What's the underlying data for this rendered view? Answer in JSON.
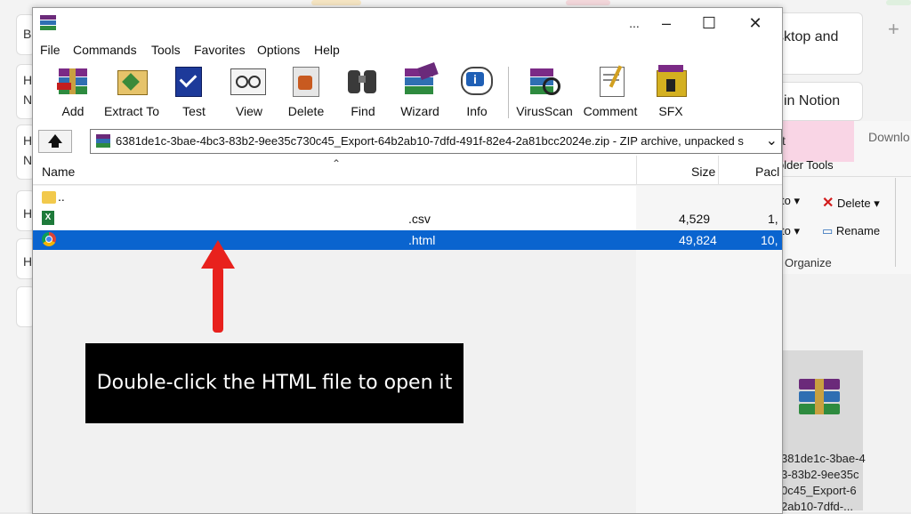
{
  "background_page": {
    "cards": [
      "sktop and",
      "in Notion"
    ],
    "sidebar_letters": [
      "B",
      "H",
      "N",
      "H",
      "N",
      "H",
      "H"
    ],
    "plus_label": "+"
  },
  "explorer": {
    "tabs": [
      "ct",
      "Downlo"
    ],
    "group_label": "older Tools",
    "move_to": "to",
    "copy_to": "to",
    "delete_label": "Delete",
    "rename_label": "Rename",
    "organize_label": "Organize",
    "file_name_lines": [
      "381de1c-3bae-4",
      "3-83b2-9ee35c",
      "0c45_Export-6",
      "2ab10-7dfd-..."
    ]
  },
  "winrar": {
    "titlebar": {
      "more": "...",
      "minimize": "–",
      "maximize": "☐",
      "close": "✕"
    },
    "menu": [
      "File",
      "Commands",
      "Tools",
      "Favorites",
      "Options",
      "Help"
    ],
    "toolbar": [
      {
        "label": "Add",
        "icon": "add-archive-icon"
      },
      {
        "label": "Extract To",
        "icon": "extract-to-icon"
      },
      {
        "label": "Test",
        "icon": "test-icon"
      },
      {
        "label": "View",
        "icon": "view-icon"
      },
      {
        "label": "Delete",
        "icon": "delete-icon"
      },
      {
        "label": "Find",
        "icon": "find-icon"
      },
      {
        "label": "Wizard",
        "icon": "wizard-icon"
      },
      {
        "label": "Info",
        "icon": "info-icon"
      },
      {
        "label": "VirusScan",
        "icon": "virus-scan-icon"
      },
      {
        "label": "Comment",
        "icon": "comment-icon"
      },
      {
        "label": "SFX",
        "icon": "sfx-icon"
      }
    ],
    "path": "6381de1c-3bae-4bc3-83b2-9ee35c730c45_Export-64b2ab10-7dfd-491f-82e4-2a81bcc2024e.zip - ZIP archive, unpacked s",
    "path_dropdown": "⌄",
    "columns": {
      "name": "Name",
      "size": "Size",
      "packed": "Pacl"
    },
    "rows": [
      {
        "name": "..",
        "ext": "",
        "size": "",
        "packed": "",
        "icon": "folder-up-icon"
      },
      {
        "name": "",
        "ext": ".csv",
        "size": "4,529",
        "packed": "1,",
        "icon": "excel-csv-icon"
      },
      {
        "name": "",
        "ext": ".html",
        "size": "49,824",
        "packed": "10,",
        "icon": "chrome-html-icon"
      }
    ],
    "selected_row_color": "#0a64cf"
  },
  "callout": {
    "text": "Double-click the HTML file to open it",
    "arrow_color": "#e8211d"
  }
}
